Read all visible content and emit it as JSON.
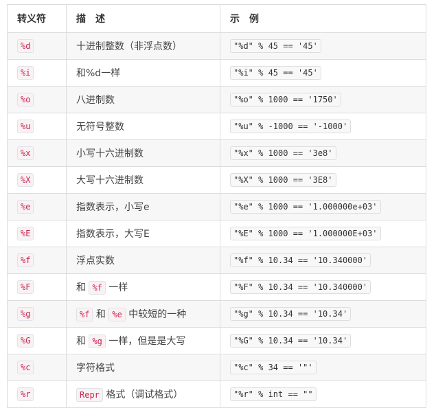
{
  "headers": {
    "symbol": "转义符",
    "description": "描　述",
    "example": "示　例"
  },
  "rows": [
    {
      "code": "%d",
      "desc": [
        {
          "t": "十进制整数（非浮点数）"
        }
      ],
      "example": "\"%d\" % 45 == '45'"
    },
    {
      "code": "%i",
      "desc": [
        {
          "t": "和%d一样"
        }
      ],
      "example": "\"%i\" % 45 == '45'"
    },
    {
      "code": "%o",
      "desc": [
        {
          "t": "八进制数"
        }
      ],
      "example": "\"%o\" % 1000 == '1750'"
    },
    {
      "code": "%u",
      "desc": [
        {
          "t": "无符号整数"
        }
      ],
      "example": "\"%u\" % -1000 == '-1000'"
    },
    {
      "code": "%x",
      "desc": [
        {
          "t": "小写十六进制数"
        }
      ],
      "example": "\"%x\" % 1000 == '3e8'"
    },
    {
      "code": "%X",
      "desc": [
        {
          "t": "大写十六进制数"
        }
      ],
      "example": "\"%X\" % 1000 == '3E8'"
    },
    {
      "code": "%e",
      "desc": [
        {
          "t": "指数表示，小写e"
        }
      ],
      "example": "\"%e\" % 1000 == '1.000000e+03'"
    },
    {
      "code": "%E",
      "desc": [
        {
          "t": "指数表示，大写E"
        }
      ],
      "example": "\"%E\" % 1000 == '1.000000E+03'"
    },
    {
      "code": "%f",
      "desc": [
        {
          "t": "浮点实数"
        }
      ],
      "example": "\"%f\" % 10.34 == '10.340000'"
    },
    {
      "code": "%F",
      "desc": [
        {
          "t": "和 "
        },
        {
          "c": "%f"
        },
        {
          "t": " 一样"
        }
      ],
      "example": "\"%F\" % 10.34 == '10.340000'"
    },
    {
      "code": "%g",
      "desc": [
        {
          "c": "%f"
        },
        {
          "t": " 和 "
        },
        {
          "c": "%e"
        },
        {
          "t": " 中较短的一种"
        }
      ],
      "example": "\"%g\" % 10.34 == '10.34'"
    },
    {
      "code": "%G",
      "desc": [
        {
          "t": "和 "
        },
        {
          "c": "%g"
        },
        {
          "t": " 一样，但是是大写"
        }
      ],
      "example": "\"%G\" % 10.34 == '10.34'"
    },
    {
      "code": "%c",
      "desc": [
        {
          "t": "字符格式"
        }
      ],
      "example": "\"%c\" % 34 == '\"'"
    },
    {
      "code": "%r",
      "desc": [
        {
          "c": "Repr"
        },
        {
          "t": " 格式（调试格式）"
        }
      ],
      "example": "\"%r\" % int == \"\""
    }
  ]
}
